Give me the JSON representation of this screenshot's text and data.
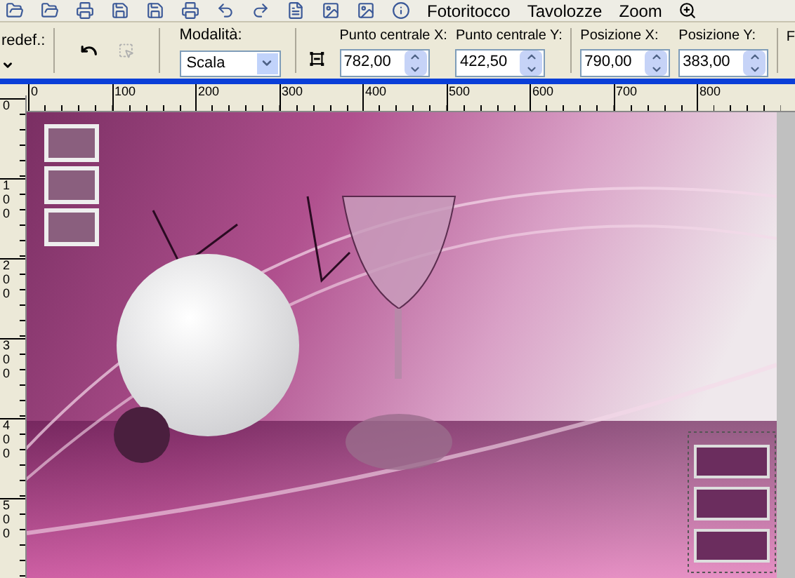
{
  "menu": [
    {
      "label": "Fotoritocco"
    },
    {
      "label": "Tavolozze"
    },
    {
      "label": "Zoom"
    }
  ],
  "toolbar": {
    "preset_label": "redef.:",
    "mode_label": "Modalità:",
    "mode_value": "Scala",
    "fields": [
      {
        "label": "Punto centrale X:",
        "value": "782,00"
      },
      {
        "label": "Punto centrale Y:",
        "value": "422,50"
      },
      {
        "label": "Posizione X:",
        "value": "790,00"
      },
      {
        "label": "Posizione Y:",
        "value": "383,00"
      }
    ],
    "next_label": "F"
  },
  "rulers": {
    "horizontal": [
      "0",
      "100",
      "200",
      "300",
      "400",
      "500",
      "600",
      "700",
      "800"
    ],
    "vertical": [
      "0",
      "100",
      "200",
      "300",
      "400",
      "500"
    ]
  }
}
